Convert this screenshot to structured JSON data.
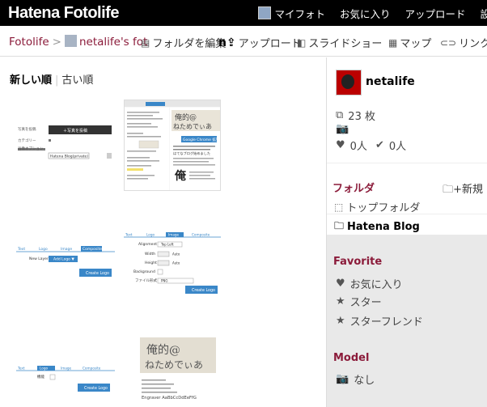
{
  "app": {
    "logo": "Hatena Fotolife"
  },
  "topnav": {
    "myfoto": "マイフォト",
    "favorites": "お気に入り",
    "upload": "アップロード",
    "settings": "設"
  },
  "breadcrumb": {
    "root": "Fotolife",
    "sep": ">",
    "user": "netalife's fot"
  },
  "toolbar": {
    "edit_folder": "フォルダを編集",
    "upload": "アップロード",
    "slideshow": "スライドショー",
    "map": "マップ",
    "link": "リンク"
  },
  "sort": {
    "newest": "新しい順",
    "sep": "|",
    "oldest": "古い順"
  },
  "thumbs": [
    {
      "text_a": "写真を投稿",
      "text_b": "Hatena Blog(private)",
      "text_c": "カテゴリー",
      "text_d": "画像オプション"
    },
    {
      "text_a": "俺的@",
      "text_b": "ねためでぃあ",
      "text_c": "Google Chrome 拡張",
      "text_d": "はてなブログ始めました",
      "text_e": "俺"
    },
    {
      "tab_1": "Text",
      "tab_2": "Logo",
      "tab_3": "Image",
      "tab_4": "Composite",
      "label": "New Layer",
      "btn": "Create Logo",
      "select": "Add Logo ▼"
    },
    {
      "tab_1": "Text",
      "tab_2": "Logo",
      "tab_3": "Image",
      "tab_4": "Composite",
      "r1": "Alignment",
      "r2": "Width",
      "r3": "Height",
      "r4": "Background",
      "r5": "ファイル形式",
      "btn": "Create Logo",
      "v1": "Top Left",
      "v2": "Auto",
      "v3": "Auto",
      "v5": "PNG"
    },
    {
      "tab_1": "Text",
      "tab_2": "Logo",
      "tab_3": "Image",
      "tab_4": "Composite",
      "label": "機能",
      "btn": "Create Logo"
    },
    {
      "text_a": "俺的@",
      "text_b": "ねためでぃあ",
      "text_c": "Engraver AaBbCcDdEeFfG"
    }
  ],
  "profile": {
    "name": "netalife",
    "count": "23 枚",
    "zero_a": "0人",
    "zero_b": "0人"
  },
  "folders": {
    "title": "フォルダ",
    "new": "新規",
    "top": "トップフォルダ",
    "hatena": "Hatena Blog"
  },
  "favorite": {
    "title": "Favorite",
    "fav": "お気に入り",
    "star": "スター",
    "starfriend": "スターフレンド"
  },
  "model": {
    "title": "Model",
    "value": "なし"
  },
  "colors": {
    "accent": "#8b1b3a",
    "topbar": "#000000",
    "sidebar_gray": "#e9e9e9"
  }
}
